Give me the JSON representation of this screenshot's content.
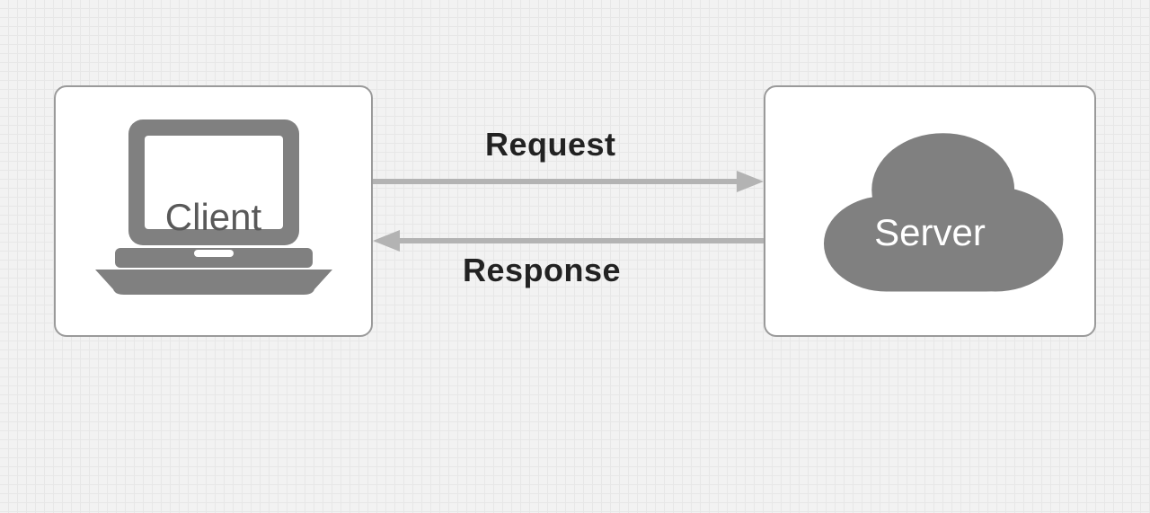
{
  "client": {
    "label": "Client"
  },
  "server": {
    "label": "Server"
  },
  "arrows": {
    "request_label": "Request",
    "response_label": "Response"
  },
  "colors": {
    "border": "#9a9a9a",
    "icon_gray": "#808080",
    "arrow_gray": "#b3b3b3",
    "label_dark": "#222222"
  }
}
